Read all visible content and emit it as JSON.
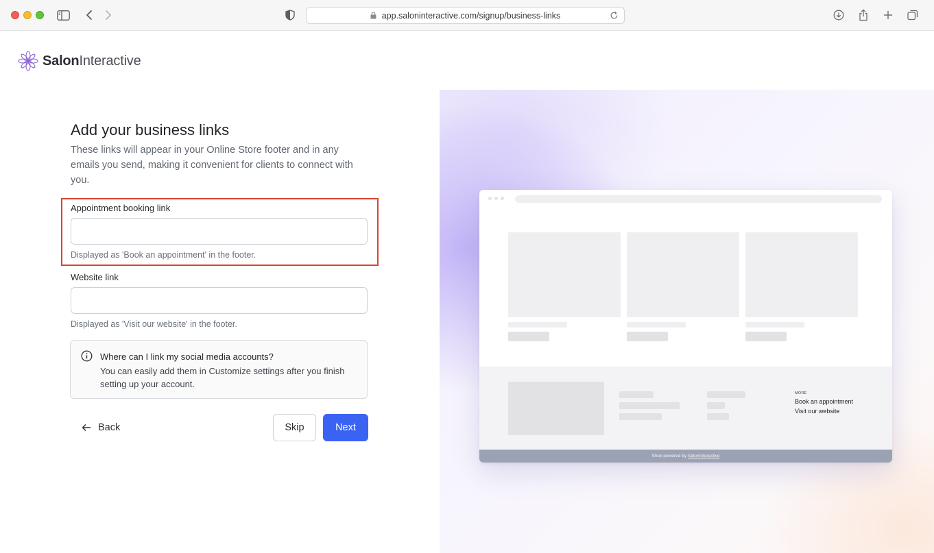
{
  "browser": {
    "url": "app.saloninteractive.com/signup/business-links"
  },
  "brand": {
    "name_bold": "Salon",
    "name_light": "Interactive",
    "accent_color": "#8a63d2"
  },
  "form": {
    "title": "Add your business links",
    "subtitle": "These links will appear in your Online Store footer and in any emails you send, making it convenient for clients to connect with you.",
    "appointment": {
      "label": "Appointment booking link",
      "value": "",
      "help": "Displayed as 'Book an appointment' in the footer."
    },
    "website": {
      "label": "Website link",
      "value": "",
      "help": "Displayed as 'Visit our website' in the footer."
    },
    "info": {
      "icon": "info-icon",
      "title": "Where can I link my social media accounts?",
      "text": "You can easily add them in Customize settings after you finish setting up your account."
    },
    "buttons": {
      "back": "Back",
      "skip": "Skip",
      "next": "Next",
      "next_color": "#3b63f3"
    },
    "highlight_color": "#d9452f"
  },
  "preview": {
    "footer_heading": "MORE",
    "footer_links": [
      "Book an appointment",
      "Visit our website"
    ],
    "powered_prefix": "Shop powered by",
    "powered_brand": "SalonInteractive"
  }
}
